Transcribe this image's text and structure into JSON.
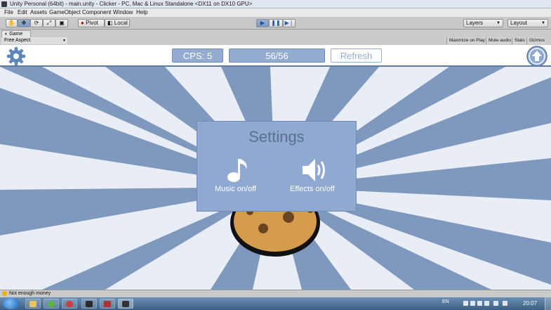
{
  "window": {
    "title": "Unity Personal (64bit) - main.unity - Clicker - PC, Mac & Linux Standalone <DX11 on DX10 GPU>"
  },
  "menu": [
    "File",
    "Edit",
    "Assets",
    "GameObject",
    "Component",
    "Window",
    "Help"
  ],
  "toolbar": {
    "pivot_label": "Pivot",
    "local_label": "Local",
    "layers_label": "Layers",
    "layout_label": "Layout"
  },
  "game_view": {
    "tab_label": "Game",
    "aspect_label": "Free Aspect",
    "options": [
      "Maximize on Play",
      "Mute audio",
      "Stats",
      "Gizmos"
    ]
  },
  "hud": {
    "cps_label": "CPS: 5",
    "count_label": "56/56",
    "refresh_label": "Refresh"
  },
  "settings": {
    "title": "Settings",
    "music_label": "Music on/off",
    "effects_label": "Effects on/off"
  },
  "status": {
    "message": "Not enough money"
  },
  "taskbar": {
    "language": "EN",
    "clock": "20:07"
  },
  "colors": {
    "accent": "#93acd0",
    "panel": "#8fa9d1",
    "ray_dark": "#7f98bd",
    "ray_light": "#e9eef6",
    "cookie": "#d59d4b"
  },
  "icons": [
    "gear-icon",
    "up-arrow-icon",
    "music-note-icon",
    "speaker-icon",
    "hand-tool-icon",
    "move-tool-icon",
    "rotate-tool-icon",
    "scale-tool-icon",
    "rect-tool-icon",
    "play-icon",
    "pause-icon",
    "step-icon"
  ]
}
